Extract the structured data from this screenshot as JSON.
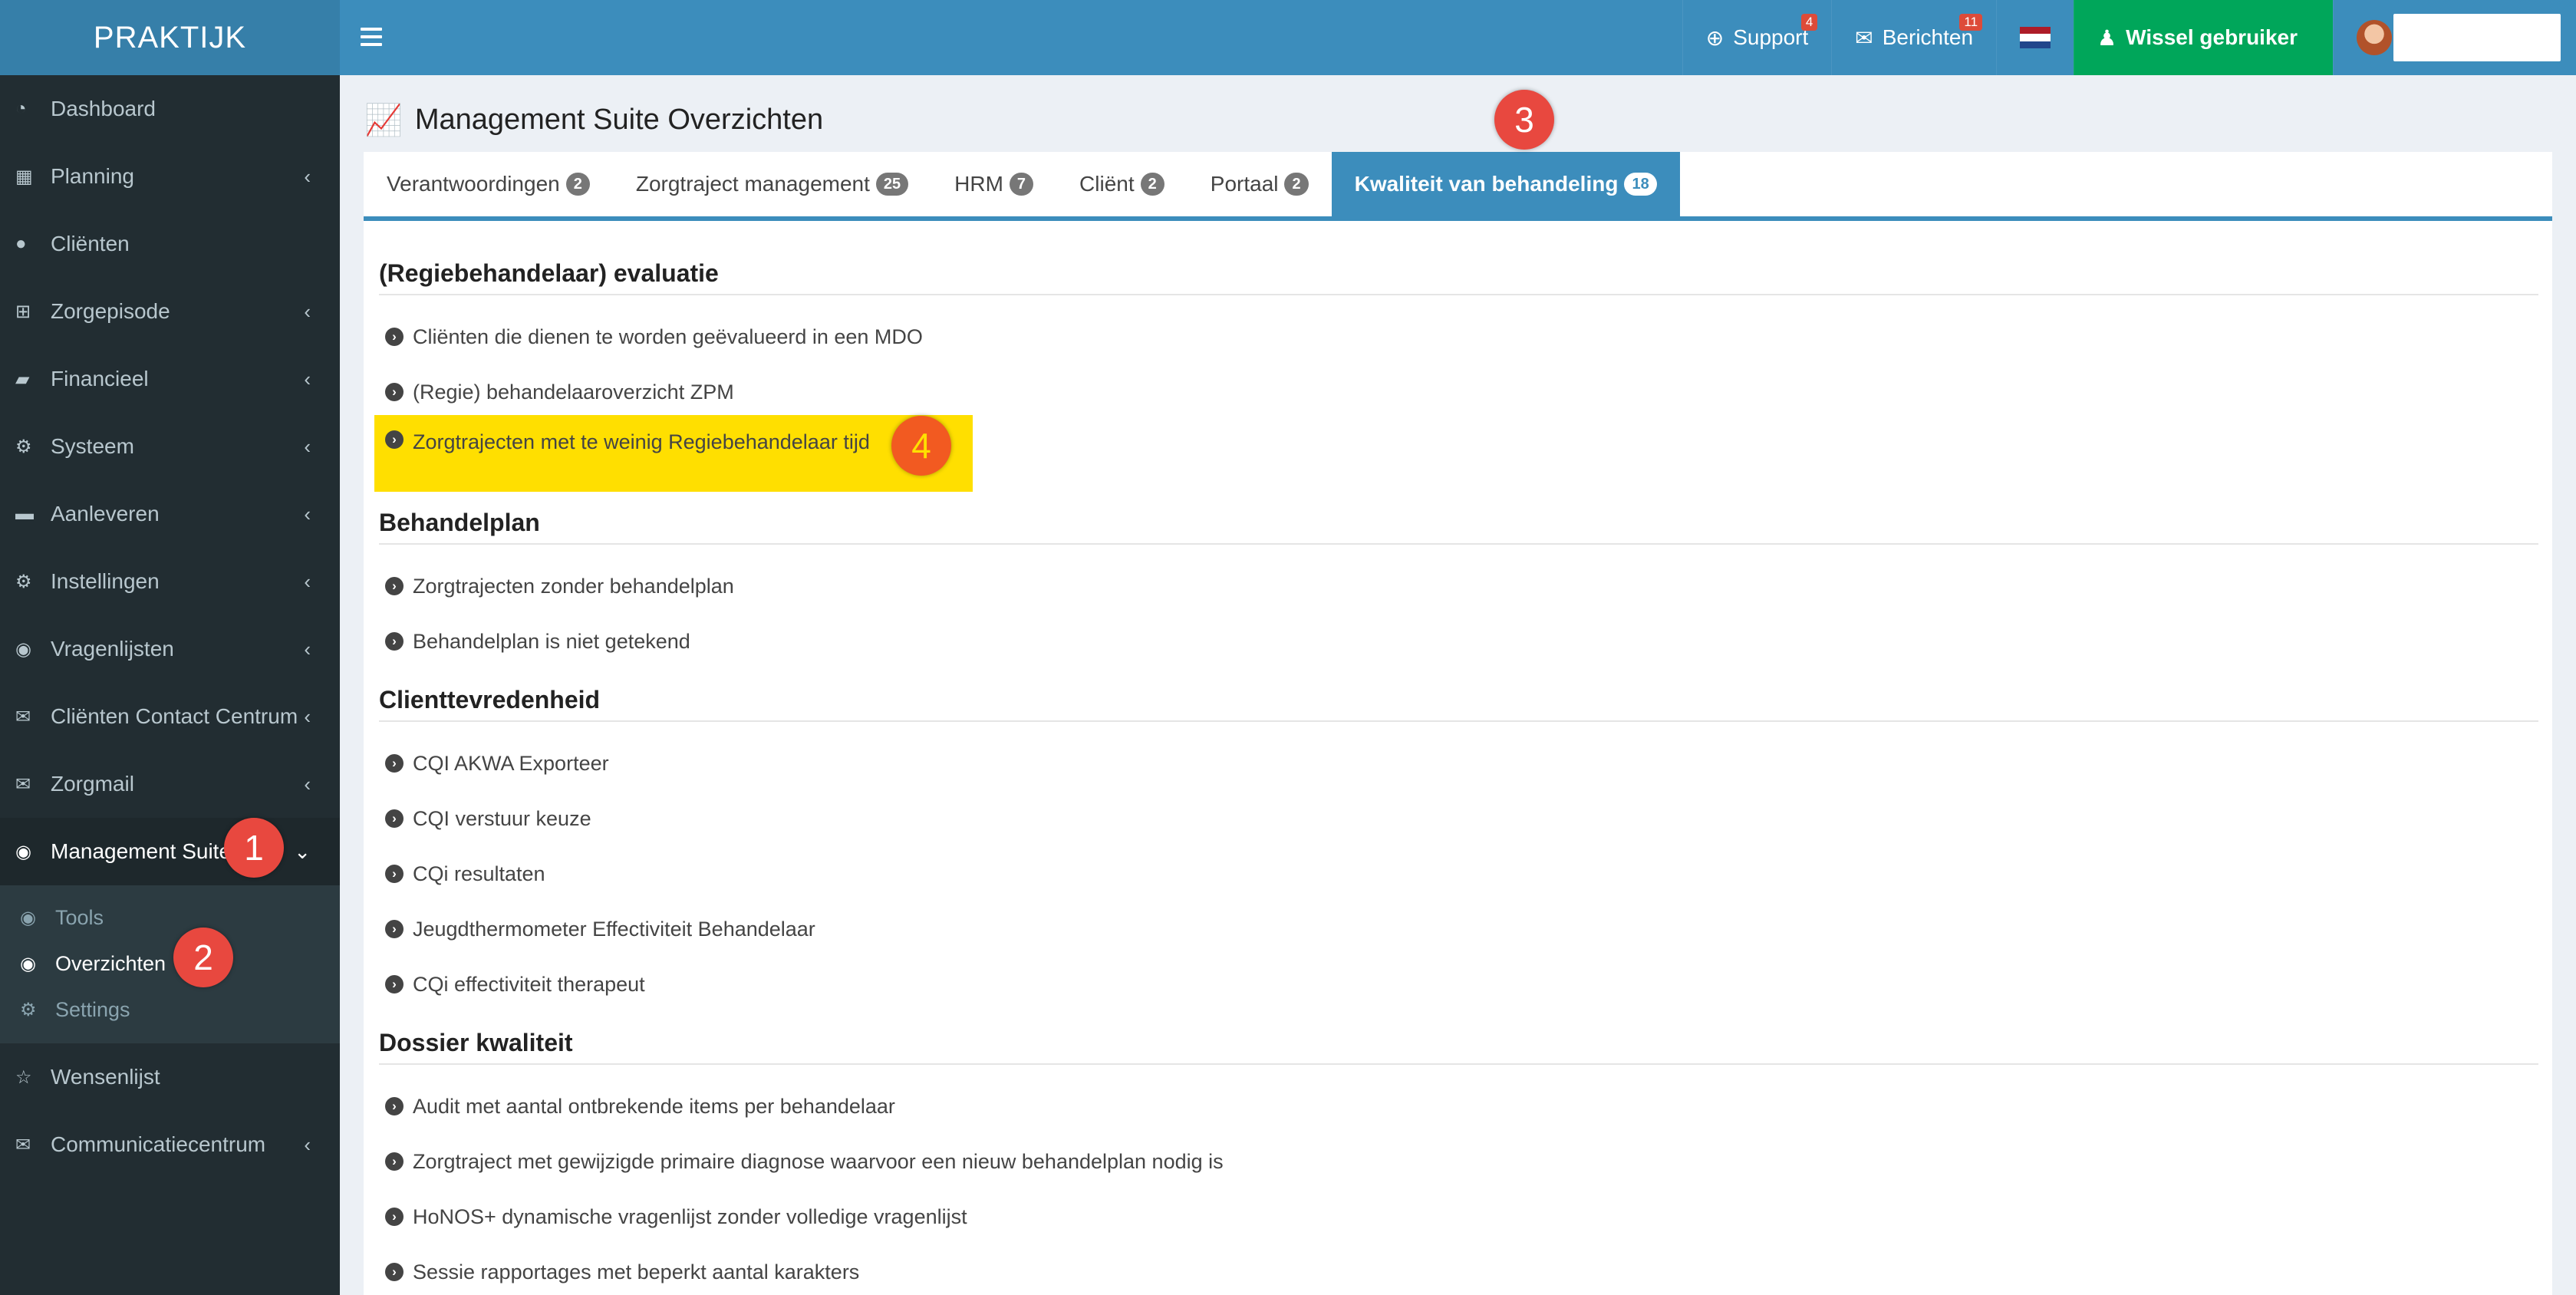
{
  "app": {
    "logo": "PRAKTIJK"
  },
  "header": {
    "support": {
      "label": "Support",
      "badge": "4"
    },
    "messages": {
      "label": "Berichten",
      "badge": "11"
    },
    "switch_user": "Wissel gebruiker"
  },
  "sidebar": {
    "items": [
      {
        "label": "Dashboard",
        "icon": "dashboard-icon"
      },
      {
        "label": "Planning",
        "icon": "calendar-icon"
      },
      {
        "label": "Cliënten",
        "icon": "user-icon"
      },
      {
        "label": "Zorgepisode",
        "icon": "medkit-icon"
      },
      {
        "label": "Financieel",
        "icon": "book-icon"
      },
      {
        "label": "Systeem",
        "icon": "cogs-icon"
      },
      {
        "label": "Aanleveren",
        "icon": "truck-icon"
      },
      {
        "label": "Instellingen",
        "icon": "gear-icon"
      },
      {
        "label": "Vragenlijsten",
        "icon": "globe-icon"
      },
      {
        "label": "Cliënten Contact Centrum",
        "icon": "envelope-icon"
      },
      {
        "label": "Zorgmail",
        "icon": "envelope-icon"
      },
      {
        "label": "Management Suite",
        "icon": "globe-icon"
      },
      {
        "label": "Wensenlijst",
        "icon": "star-icon"
      },
      {
        "label": "Communicatiecentrum",
        "icon": "envelope-icon"
      }
    ],
    "submenu": [
      {
        "label": "Tools"
      },
      {
        "label": "Overzichten"
      },
      {
        "label": "Settings"
      }
    ]
  },
  "annotations": [
    "1",
    "2",
    "3",
    "4"
  ],
  "page": {
    "title": "Management Suite Overzichten"
  },
  "tabs": [
    {
      "label": "Verantwoordingen",
      "count": "2"
    },
    {
      "label": "Zorgtraject management",
      "count": "25"
    },
    {
      "label": "HRM",
      "count": "7"
    },
    {
      "label": "Cliënt",
      "count": "2"
    },
    {
      "label": "Portaal",
      "count": "2"
    },
    {
      "label": "Kwaliteit van behandeling",
      "count": "18"
    }
  ],
  "sections": [
    {
      "title": "(Regiebehandelaar) evaluatie",
      "links": [
        "Cliënten die dienen te worden geëvalueerd in een MDO",
        "(Regie) behandelaaroverzicht ZPM",
        "Zorgtrajecten met te weinig Regiebehandelaar tijd"
      ]
    },
    {
      "title": "Behandelplan",
      "links": [
        "Zorgtrajecten zonder behandelplan",
        "Behandelplan is niet getekend"
      ]
    },
    {
      "title": "Clienttevredenheid",
      "links": [
        "CQI AKWA Exporteer",
        "CQI verstuur keuze",
        "CQi resultaten",
        "Jeugdthermometer Effectiviteit Behandelaar",
        "CQi effectiviteit therapeut"
      ]
    },
    {
      "title": "Dossier kwaliteit",
      "links": [
        "Audit met aantal ontbrekende items per behandelaar",
        "Zorgtraject met gewijzigde primaire diagnose waarvoor een nieuw behandelplan nodig is",
        "HoNOS+ dynamische vragenlijst zonder volledige vragenlijst",
        "Sessie rapportages met beperkt aantal karakters"
      ]
    }
  ],
  "colors": {
    "header": "#3c8dbc",
    "sidebar": "#222d32",
    "switch": "#00a65a",
    "highlight": "#ffdf00",
    "annotation": "#e8483f"
  }
}
